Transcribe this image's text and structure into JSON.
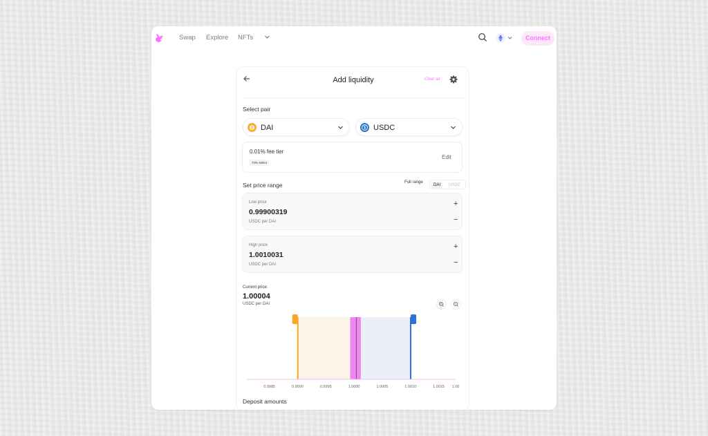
{
  "nav": {
    "links": [
      "Swap",
      "Explore",
      "NFTs"
    ],
    "connect_label": "Connect",
    "icons": [
      "uniswap-logo",
      "chevron-down-icon",
      "search-icon",
      "ethereum-icon"
    ]
  },
  "card": {
    "title": "Add liquidity",
    "clear_all": "Clear all",
    "select_pair_label": "Select pair",
    "token_a": "DAI",
    "token_b": "USDC",
    "fee_tier": "0.01% fee tier",
    "fee_select": "74% select",
    "edit_label": "Edit",
    "set_price_range_label": "Set price range",
    "full_range_label": "Full range",
    "toggle_a": "DAI",
    "toggle_b": "USDC",
    "low_price": {
      "label": "Low price",
      "value": "0.99900319",
      "unit": "USDC per DAI"
    },
    "high_price": {
      "label": "High price",
      "value": "1.0010031",
      "unit": "USDC per DAI"
    },
    "current_price_label": "Current price:",
    "current_price_value": "1.00004",
    "current_price_unit": "USDC per DAI",
    "deposit_label": "Deposit amounts"
  },
  "colors": {
    "accent_pink": "#fc72ff",
    "dai_yellow": "#f5ac37",
    "usdc_blue": "#2775ca",
    "range_blue": "#2c6fd6",
    "range_orange": "#f7a829"
  },
  "chart_data": {
    "type": "area",
    "x_ticks": [
      "0.9985",
      "0.9990",
      "0.9995",
      "1.0000",
      "1.0005",
      "1.0010",
      "1.0015",
      "1.00"
    ],
    "xlim": [
      0.9981,
      1.0018
    ],
    "current_price": 1.00004,
    "range_low": 0.99900319,
    "range_high": 1.0010031,
    "liquidity_band": [
      0.99993,
      1.00012
    ]
  }
}
